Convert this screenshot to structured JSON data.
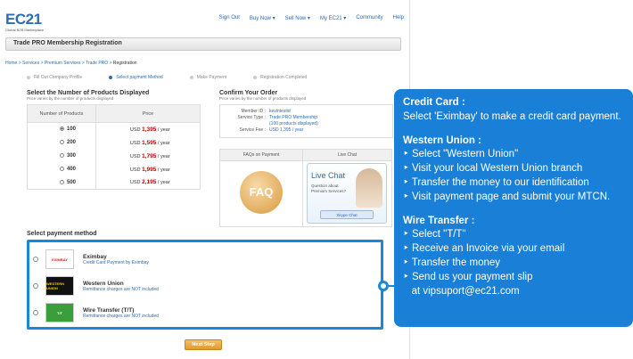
{
  "header": {
    "logo": "EC21",
    "logo_sub": "Global B2B Marketplace",
    "nav": [
      "Sign Out",
      "Buy Now ▾",
      "Sell Now ▾",
      "My EC21 ▾",
      "Community",
      "Help"
    ],
    "page_title": "Trade PRO Membership Registration"
  },
  "breadcrumb": {
    "path": "Home > Services > Premium Services > Trade PRO > ",
    "current": "Registration"
  },
  "steps": [
    "Fill Out Company Profile",
    "Select payment Method",
    "Make Payment",
    "Registration Completed"
  ],
  "products": {
    "title": "Select the Number of Products Displayed",
    "note": "Price varies by the number of products displayed",
    "col_qty": "Number of Products",
    "col_price": "Price",
    "rows": [
      {
        "qty": "100",
        "prefix": "USD",
        "price": "1,395",
        "suffix": "/ year",
        "selected": true
      },
      {
        "qty": "200",
        "prefix": "USD",
        "price": "1,595",
        "suffix": "/ year",
        "selected": false
      },
      {
        "qty": "300",
        "prefix": "USD",
        "price": "1,795",
        "suffix": "/ year",
        "selected": false
      },
      {
        "qty": "400",
        "prefix": "USD",
        "price": "1,995",
        "suffix": "/ year",
        "selected": false
      },
      {
        "qty": "500",
        "prefix": "USD",
        "price": "2,195",
        "suffix": "/ year",
        "selected": false
      }
    ]
  },
  "order": {
    "title": "Confirm Your Order",
    "note": "Price varies by the number of products displayed",
    "member_id_label": "Member ID :",
    "member_id": "kevintestid",
    "service_type_label": "Service Type :",
    "service_type": "Trade PRO Membership",
    "service_type_sub": "(100 products displayed)",
    "service_fee_label": "Service Fee :",
    "service_fee": "USD 1,395 / year"
  },
  "faq": {
    "header": "FAQs on Payment",
    "badge": "FAQ"
  },
  "chat": {
    "header": "Live Chat",
    "title": "Live Chat",
    "question": "Question about Premium Services?",
    "skype": "Skype Chat"
  },
  "payment": {
    "title": "Select payment method",
    "methods": [
      {
        "name": "Eximbay",
        "desc": "Credit Card Payment by Eximbay",
        "logo": "EXIMBAY"
      },
      {
        "name": "Western Union",
        "desc": "Remittance charges are NOT included",
        "logo": "WESTERN UNION"
      },
      {
        "name": "Wire Transfer (T/T)",
        "desc": "Remittance charges are NOT included",
        "logo": "T/T"
      }
    ],
    "next": "Next Step"
  },
  "callout": {
    "credit_title": "Credit Card :",
    "credit_body": "Select 'Eximbay' to make a credit card payment.",
    "wu_title": "Western Union :",
    "wu_items": [
      "‣ Select \"Western Union\"",
      "‣ Visit your local Western Union branch",
      "‣ Transfer the money to our identification",
      "‣ Visit payment page and submit your MTCN."
    ],
    "wire_title": "Wire Transfer :",
    "wire_items": [
      "‣ Select  \"T/T\"",
      "‣ Receive an Invoice via your email",
      "‣ Transfer the money",
      "‣ Send us your payment slip",
      "   at vipsuport@ec21.com"
    ]
  }
}
